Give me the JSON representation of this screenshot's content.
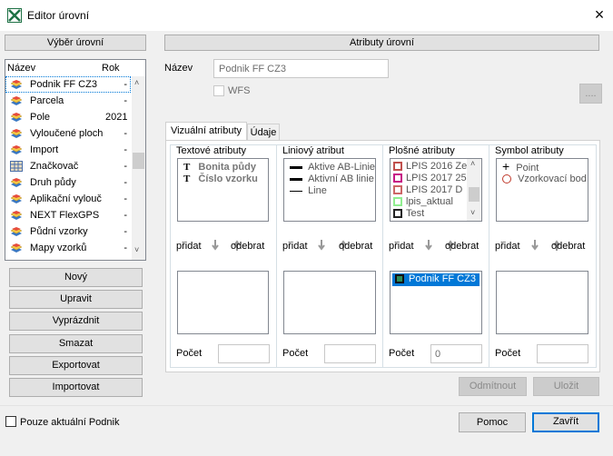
{
  "window": {
    "title": "Editor úrovní",
    "close_symbol": "×"
  },
  "left": {
    "header": "Výběr úrovní",
    "list_headers": {
      "name": "Název",
      "year": "Rok"
    },
    "items": [
      {
        "name": "Podnik FF CZ3",
        "year": "-",
        "icon": "layer-icon"
      },
      {
        "name": "Parcela",
        "year": "-",
        "icon": "layer-icon"
      },
      {
        "name": "Pole",
        "year": "2021",
        "icon": "layer-icon"
      },
      {
        "name": "Vyloučené ploch",
        "year": "-",
        "icon": "layer-icon"
      },
      {
        "name": "Import",
        "year": "-",
        "icon": "layer-icon"
      },
      {
        "name": "Značkovač",
        "year": "-",
        "icon": "grid-layer-icon"
      },
      {
        "name": "Druh půdy",
        "year": "-",
        "icon": "layer-icon"
      },
      {
        "name": "Aplikační vylouč",
        "year": "-",
        "icon": "layer-icon"
      },
      {
        "name": "NEXT FlexGPS",
        "year": "-",
        "icon": "layer-icon"
      },
      {
        "name": "Půdní vzorky",
        "year": "-",
        "icon": "layer-icon"
      },
      {
        "name": "Mapy vzorků",
        "year": "-",
        "icon": "layer-icon"
      }
    ],
    "buttons": {
      "new": "Nový",
      "edit": "Upravit",
      "empty": "Vyprázdnit",
      "delete": "Smazat",
      "export": "Exportovat",
      "import": "Importovat"
    }
  },
  "right": {
    "header": "Atributy úrovní",
    "name_label": "Název",
    "name_value": "Podnik FF CZ3",
    "wfs_label": "WFS",
    "more_button": "....",
    "tabs": [
      "Vizuální atributy",
      "Údaje"
    ],
    "add_label": "přidat",
    "remove_label": "odebrat",
    "count_label": "Počet",
    "columns": {
      "text": {
        "title": "Textové atributy",
        "items": [
          "Bonita půdy",
          "Číslo vzorku"
        ],
        "count": ""
      },
      "line": {
        "title": "Liniový atribut",
        "items": [
          "Aktive AB-Linie",
          "Aktivní AB linie",
          "Line"
        ],
        "count": ""
      },
      "area": {
        "title": "Plošné atributy",
        "items": [
          "LPIS 2016 Ze",
          "LPIS 2017 25",
          "LPIS 2017 D",
          "lpis_aktual",
          "Test"
        ],
        "colors": [
          "#c0504d",
          "#c71585",
          "#cc6666",
          "#90ee90",
          "#222222"
        ],
        "selected": [
          "Podnik FF CZ3"
        ],
        "count": "0"
      },
      "symbol": {
        "title": "Symbol atributy",
        "items": [
          "Point",
          "Vzorkovací bod"
        ],
        "count": ""
      }
    },
    "buttons": {
      "reject": "Odmítnout",
      "save": "Uložit"
    }
  },
  "footer": {
    "only_current_label": "Pouze aktuální Podnik",
    "help": "Pomoc",
    "close": "Zavřít"
  }
}
